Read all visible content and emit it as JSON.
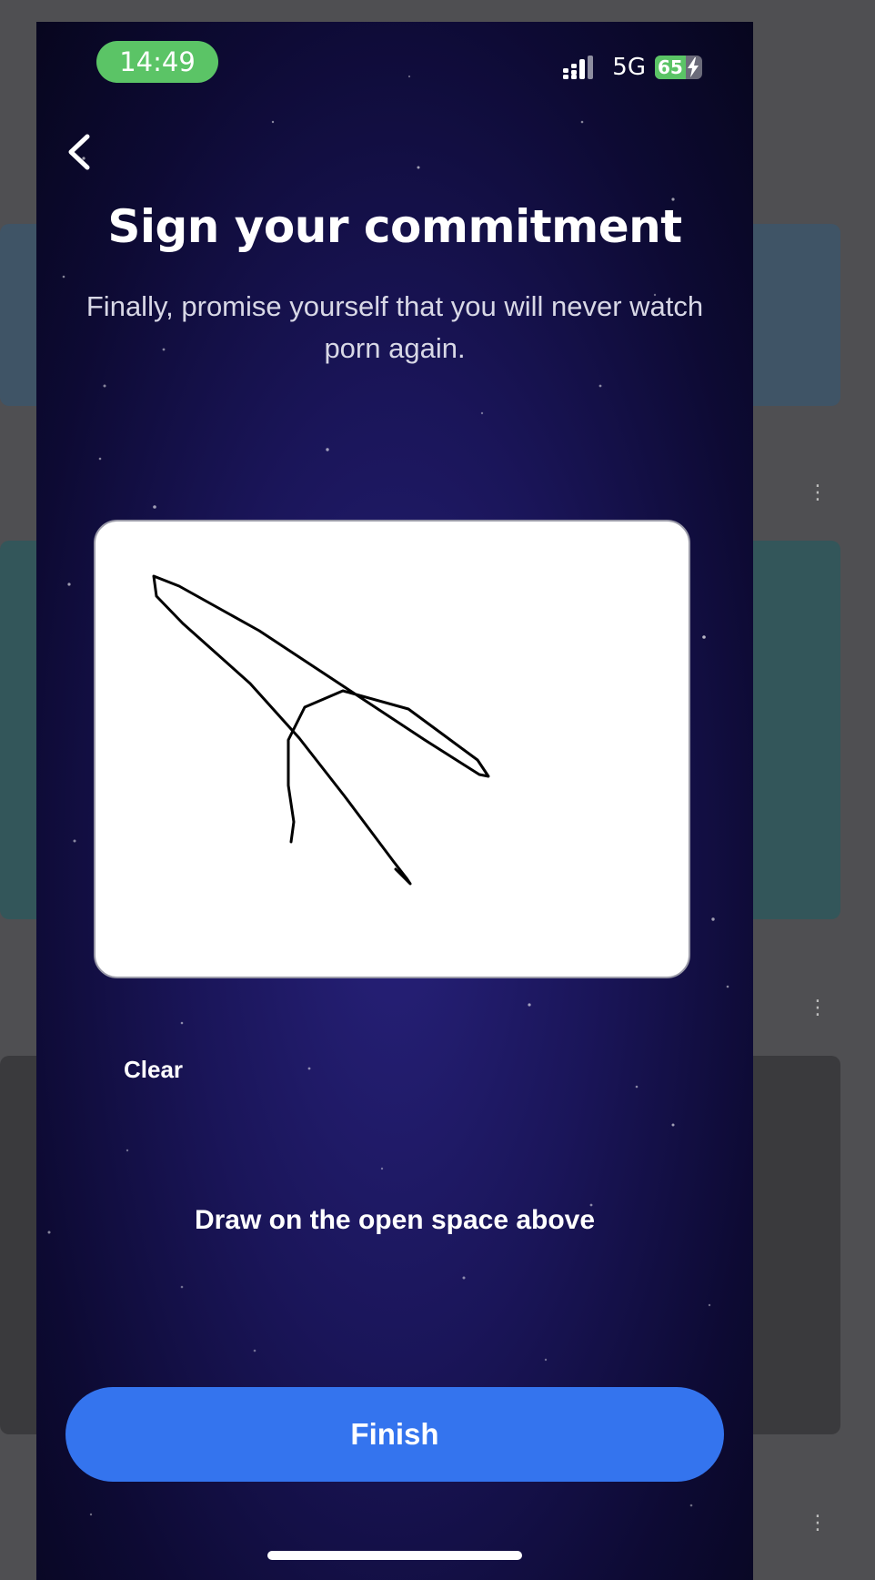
{
  "status_bar": {
    "time": "14:49",
    "network": "5G",
    "battery": "65",
    "battery_level_percent": 65,
    "time_pill_color": "#5bc466"
  },
  "icons": {
    "back": "chevron-left-icon",
    "signal": "signal-bars-icon",
    "battery": "battery-charging-icon"
  },
  "header": {
    "title": "Sign your commitment",
    "subtitle": "Finally, promise yourself that you will never watch porn again."
  },
  "signature_pad": {
    "has_signature": true
  },
  "actions": {
    "clear_label": "Clear",
    "hint": "Draw on the open space above",
    "finish_label": "Finish",
    "finish_color": "#3474ee"
  }
}
